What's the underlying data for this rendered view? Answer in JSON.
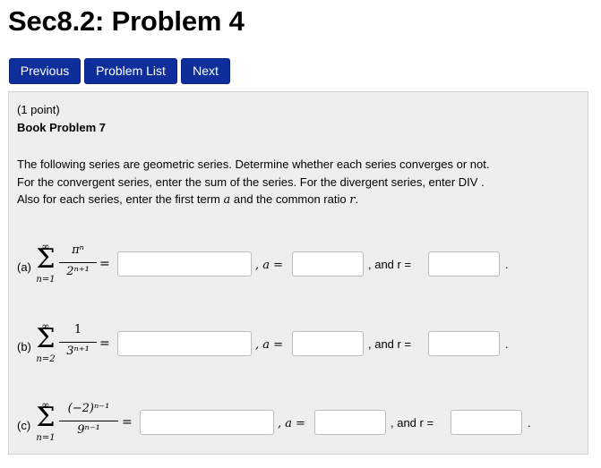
{
  "page": {
    "title": "Sec8.2: Problem 4"
  },
  "nav": {
    "previous": "Previous",
    "problem_list": "Problem List",
    "next": "Next"
  },
  "problem": {
    "points": "(1 point)",
    "source": "Book Problem 7",
    "line1": "The following series are geometric series. Determine whether each series converges or not.",
    "line2": "For the convergent series, enter the sum of the series. For the divergent series, enter DIV .",
    "line3_pre": "Also for each series, enter the first term ",
    "line3_a": "a",
    "line3_mid": " and the common ratio ",
    "line3_r": "r",
    "line3_end": "."
  },
  "parts": [
    {
      "label": "(a)",
      "upper": "∞",
      "lower": "n=1",
      "numerator": "πⁿ",
      "denominator": "2ⁿ⁺¹",
      "eq": "=",
      "a_label": ", a =",
      "r_label": ", and r =",
      "end": ".",
      "sum_value": "",
      "a_value": "",
      "r_value": ""
    },
    {
      "label": "(b)",
      "upper": "∞",
      "lower": "n=2",
      "numerator": "1",
      "denominator": "3ⁿ⁺¹",
      "eq": "=",
      "a_label": ", a =",
      "r_label": ", and r =",
      "end": ".",
      "sum_value": "",
      "a_value": "",
      "r_value": ""
    },
    {
      "label": "(c)",
      "upper": "∞",
      "lower": "n=1",
      "numerator": "(−2)ⁿ⁻¹",
      "denominator": "9ⁿ⁻¹",
      "eq": "=",
      "a_label": ", a =",
      "r_label": ", and r =",
      "end": ".",
      "sum_value": "",
      "a_value": "",
      "r_value": ""
    }
  ]
}
